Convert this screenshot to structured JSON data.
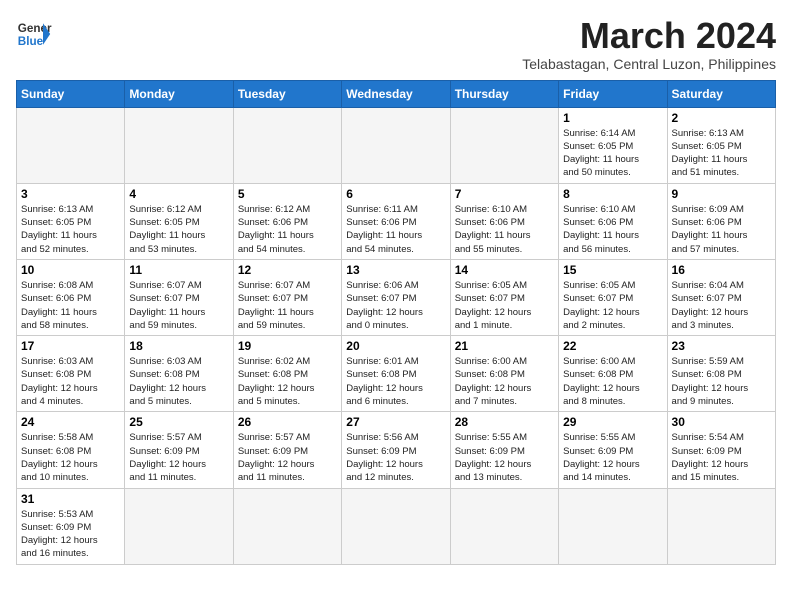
{
  "header": {
    "logo_general": "General",
    "logo_blue": "Blue",
    "month_title": "March 2024",
    "subtitle": "Telabastagan, Central Luzon, Philippines"
  },
  "weekdays": [
    "Sunday",
    "Monday",
    "Tuesday",
    "Wednesday",
    "Thursday",
    "Friday",
    "Saturday"
  ],
  "weeks": [
    [
      {
        "day": "",
        "info": ""
      },
      {
        "day": "",
        "info": ""
      },
      {
        "day": "",
        "info": ""
      },
      {
        "day": "",
        "info": ""
      },
      {
        "day": "",
        "info": ""
      },
      {
        "day": "1",
        "info": "Sunrise: 6:14 AM\nSunset: 6:05 PM\nDaylight: 11 hours\nand 50 minutes."
      },
      {
        "day": "2",
        "info": "Sunrise: 6:13 AM\nSunset: 6:05 PM\nDaylight: 11 hours\nand 51 minutes."
      }
    ],
    [
      {
        "day": "3",
        "info": "Sunrise: 6:13 AM\nSunset: 6:05 PM\nDaylight: 11 hours\nand 52 minutes."
      },
      {
        "day": "4",
        "info": "Sunrise: 6:12 AM\nSunset: 6:05 PM\nDaylight: 11 hours\nand 53 minutes."
      },
      {
        "day": "5",
        "info": "Sunrise: 6:12 AM\nSunset: 6:06 PM\nDaylight: 11 hours\nand 54 minutes."
      },
      {
        "day": "6",
        "info": "Sunrise: 6:11 AM\nSunset: 6:06 PM\nDaylight: 11 hours\nand 54 minutes."
      },
      {
        "day": "7",
        "info": "Sunrise: 6:10 AM\nSunset: 6:06 PM\nDaylight: 11 hours\nand 55 minutes."
      },
      {
        "day": "8",
        "info": "Sunrise: 6:10 AM\nSunset: 6:06 PM\nDaylight: 11 hours\nand 56 minutes."
      },
      {
        "day": "9",
        "info": "Sunrise: 6:09 AM\nSunset: 6:06 PM\nDaylight: 11 hours\nand 57 minutes."
      }
    ],
    [
      {
        "day": "10",
        "info": "Sunrise: 6:08 AM\nSunset: 6:06 PM\nDaylight: 11 hours\nand 58 minutes."
      },
      {
        "day": "11",
        "info": "Sunrise: 6:07 AM\nSunset: 6:07 PM\nDaylight: 11 hours\nand 59 minutes."
      },
      {
        "day": "12",
        "info": "Sunrise: 6:07 AM\nSunset: 6:07 PM\nDaylight: 11 hours\nand 59 minutes."
      },
      {
        "day": "13",
        "info": "Sunrise: 6:06 AM\nSunset: 6:07 PM\nDaylight: 12 hours\nand 0 minutes."
      },
      {
        "day": "14",
        "info": "Sunrise: 6:05 AM\nSunset: 6:07 PM\nDaylight: 12 hours\nand 1 minute."
      },
      {
        "day": "15",
        "info": "Sunrise: 6:05 AM\nSunset: 6:07 PM\nDaylight: 12 hours\nand 2 minutes."
      },
      {
        "day": "16",
        "info": "Sunrise: 6:04 AM\nSunset: 6:07 PM\nDaylight: 12 hours\nand 3 minutes."
      }
    ],
    [
      {
        "day": "17",
        "info": "Sunrise: 6:03 AM\nSunset: 6:08 PM\nDaylight: 12 hours\nand 4 minutes."
      },
      {
        "day": "18",
        "info": "Sunrise: 6:03 AM\nSunset: 6:08 PM\nDaylight: 12 hours\nand 5 minutes."
      },
      {
        "day": "19",
        "info": "Sunrise: 6:02 AM\nSunset: 6:08 PM\nDaylight: 12 hours\nand 5 minutes."
      },
      {
        "day": "20",
        "info": "Sunrise: 6:01 AM\nSunset: 6:08 PM\nDaylight: 12 hours\nand 6 minutes."
      },
      {
        "day": "21",
        "info": "Sunrise: 6:00 AM\nSunset: 6:08 PM\nDaylight: 12 hours\nand 7 minutes."
      },
      {
        "day": "22",
        "info": "Sunrise: 6:00 AM\nSunset: 6:08 PM\nDaylight: 12 hours\nand 8 minutes."
      },
      {
        "day": "23",
        "info": "Sunrise: 5:59 AM\nSunset: 6:08 PM\nDaylight: 12 hours\nand 9 minutes."
      }
    ],
    [
      {
        "day": "24",
        "info": "Sunrise: 5:58 AM\nSunset: 6:08 PM\nDaylight: 12 hours\nand 10 minutes."
      },
      {
        "day": "25",
        "info": "Sunrise: 5:57 AM\nSunset: 6:09 PM\nDaylight: 12 hours\nand 11 minutes."
      },
      {
        "day": "26",
        "info": "Sunrise: 5:57 AM\nSunset: 6:09 PM\nDaylight: 12 hours\nand 11 minutes."
      },
      {
        "day": "27",
        "info": "Sunrise: 5:56 AM\nSunset: 6:09 PM\nDaylight: 12 hours\nand 12 minutes."
      },
      {
        "day": "28",
        "info": "Sunrise: 5:55 AM\nSunset: 6:09 PM\nDaylight: 12 hours\nand 13 minutes."
      },
      {
        "day": "29",
        "info": "Sunrise: 5:55 AM\nSunset: 6:09 PM\nDaylight: 12 hours\nand 14 minutes."
      },
      {
        "day": "30",
        "info": "Sunrise: 5:54 AM\nSunset: 6:09 PM\nDaylight: 12 hours\nand 15 minutes."
      }
    ],
    [
      {
        "day": "31",
        "info": "Sunrise: 5:53 AM\nSunset: 6:09 PM\nDaylight: 12 hours\nand 16 minutes."
      },
      {
        "day": "",
        "info": ""
      },
      {
        "day": "",
        "info": ""
      },
      {
        "day": "",
        "info": ""
      },
      {
        "day": "",
        "info": ""
      },
      {
        "day": "",
        "info": ""
      },
      {
        "day": "",
        "info": ""
      }
    ]
  ]
}
